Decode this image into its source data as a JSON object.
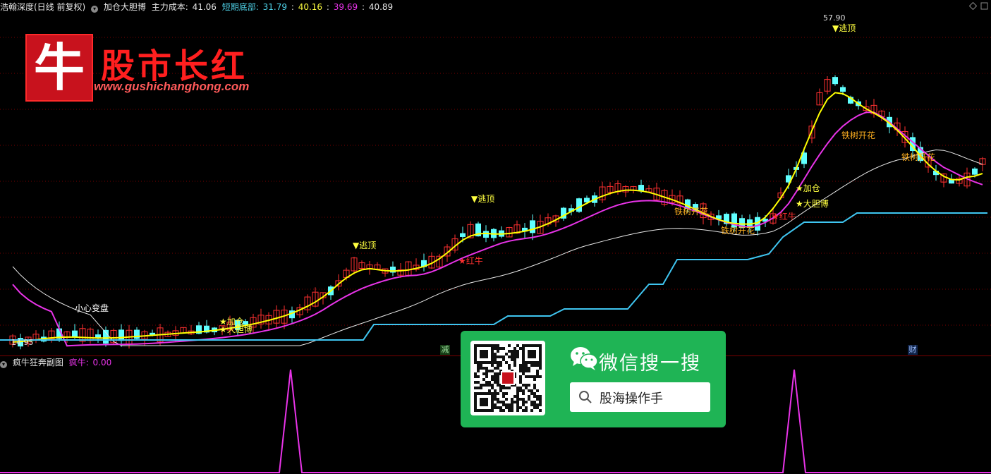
{
  "header": {
    "title": "浩翰深度(日线 前复权)",
    "indicator_name": "加仓大胆博",
    "cost_label": "主力成本:",
    "cost_value": "41.06",
    "bottom_label": "短期底部:",
    "bottom_value_1": "31.79",
    "bottom_sep": ":",
    "bottom_value_2": "40.16",
    "bottom_value_3": "39.69",
    "bottom_value_4": "40.89"
  },
  "sub_header": {
    "title": "疯牛狂奔副图",
    "label": "疯牛:",
    "value": "0.00"
  },
  "brand": {
    "logo_char": "牛",
    "name": "股市长红",
    "url": "www.gushichanghong.com"
  },
  "wechat": {
    "title": "微信搜一搜",
    "search_text": "股海操作手"
  },
  "annotations": {
    "high_price": "57.90",
    "low_price": "14.95",
    "escape_top": "▼逃顶",
    "red_bull": "★红牛",
    "iron_tree": "铁树开花",
    "add_pos": "★加仓",
    "bold_bet": "★大胆博",
    "caution": "小心变盘",
    "reduce_marker": "减",
    "finance_marker": "财"
  },
  "colors": {
    "cyan": "#4fd2e8",
    "yellow": "#ffff00",
    "magenta": "#e833e8",
    "red": "#ff2020",
    "bear": "#60ffff"
  }
}
